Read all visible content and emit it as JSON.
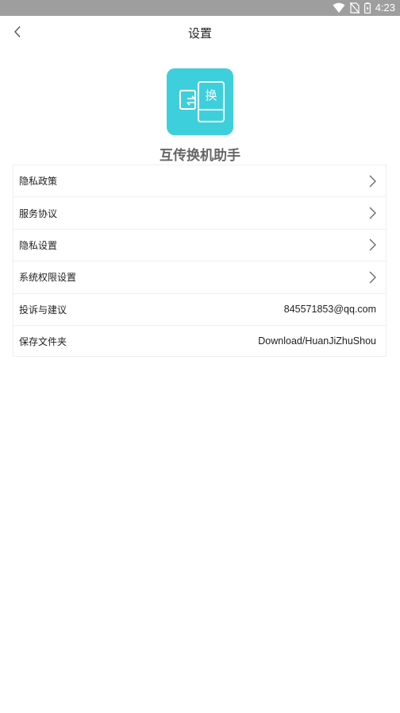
{
  "status_bar": {
    "time": "4:23",
    "icons": [
      "wifi-icon",
      "no-sim-icon",
      "battery-icon"
    ]
  },
  "app_bar": {
    "title": "设置",
    "back_icon": "chevron-left-icon"
  },
  "app": {
    "logo_icon": "phone-transfer-icon",
    "logo_glyph": "换",
    "name": "互传换机助手",
    "accent_color": "#3ecfdc"
  },
  "settings": {
    "items": [
      {
        "label": "隐私政策",
        "value": "",
        "chevron": true
      },
      {
        "label": "服务协议",
        "value": "",
        "chevron": true
      },
      {
        "label": "隐私设置",
        "value": "",
        "chevron": true
      },
      {
        "label": "系统权限设置",
        "value": "",
        "chevron": true
      },
      {
        "label": "投诉与建议",
        "value": "845571853@qq.com",
        "chevron": false
      },
      {
        "label": "保存文件夹",
        "value": "Download/HuanJiZhuShou",
        "chevron": false
      }
    ]
  }
}
